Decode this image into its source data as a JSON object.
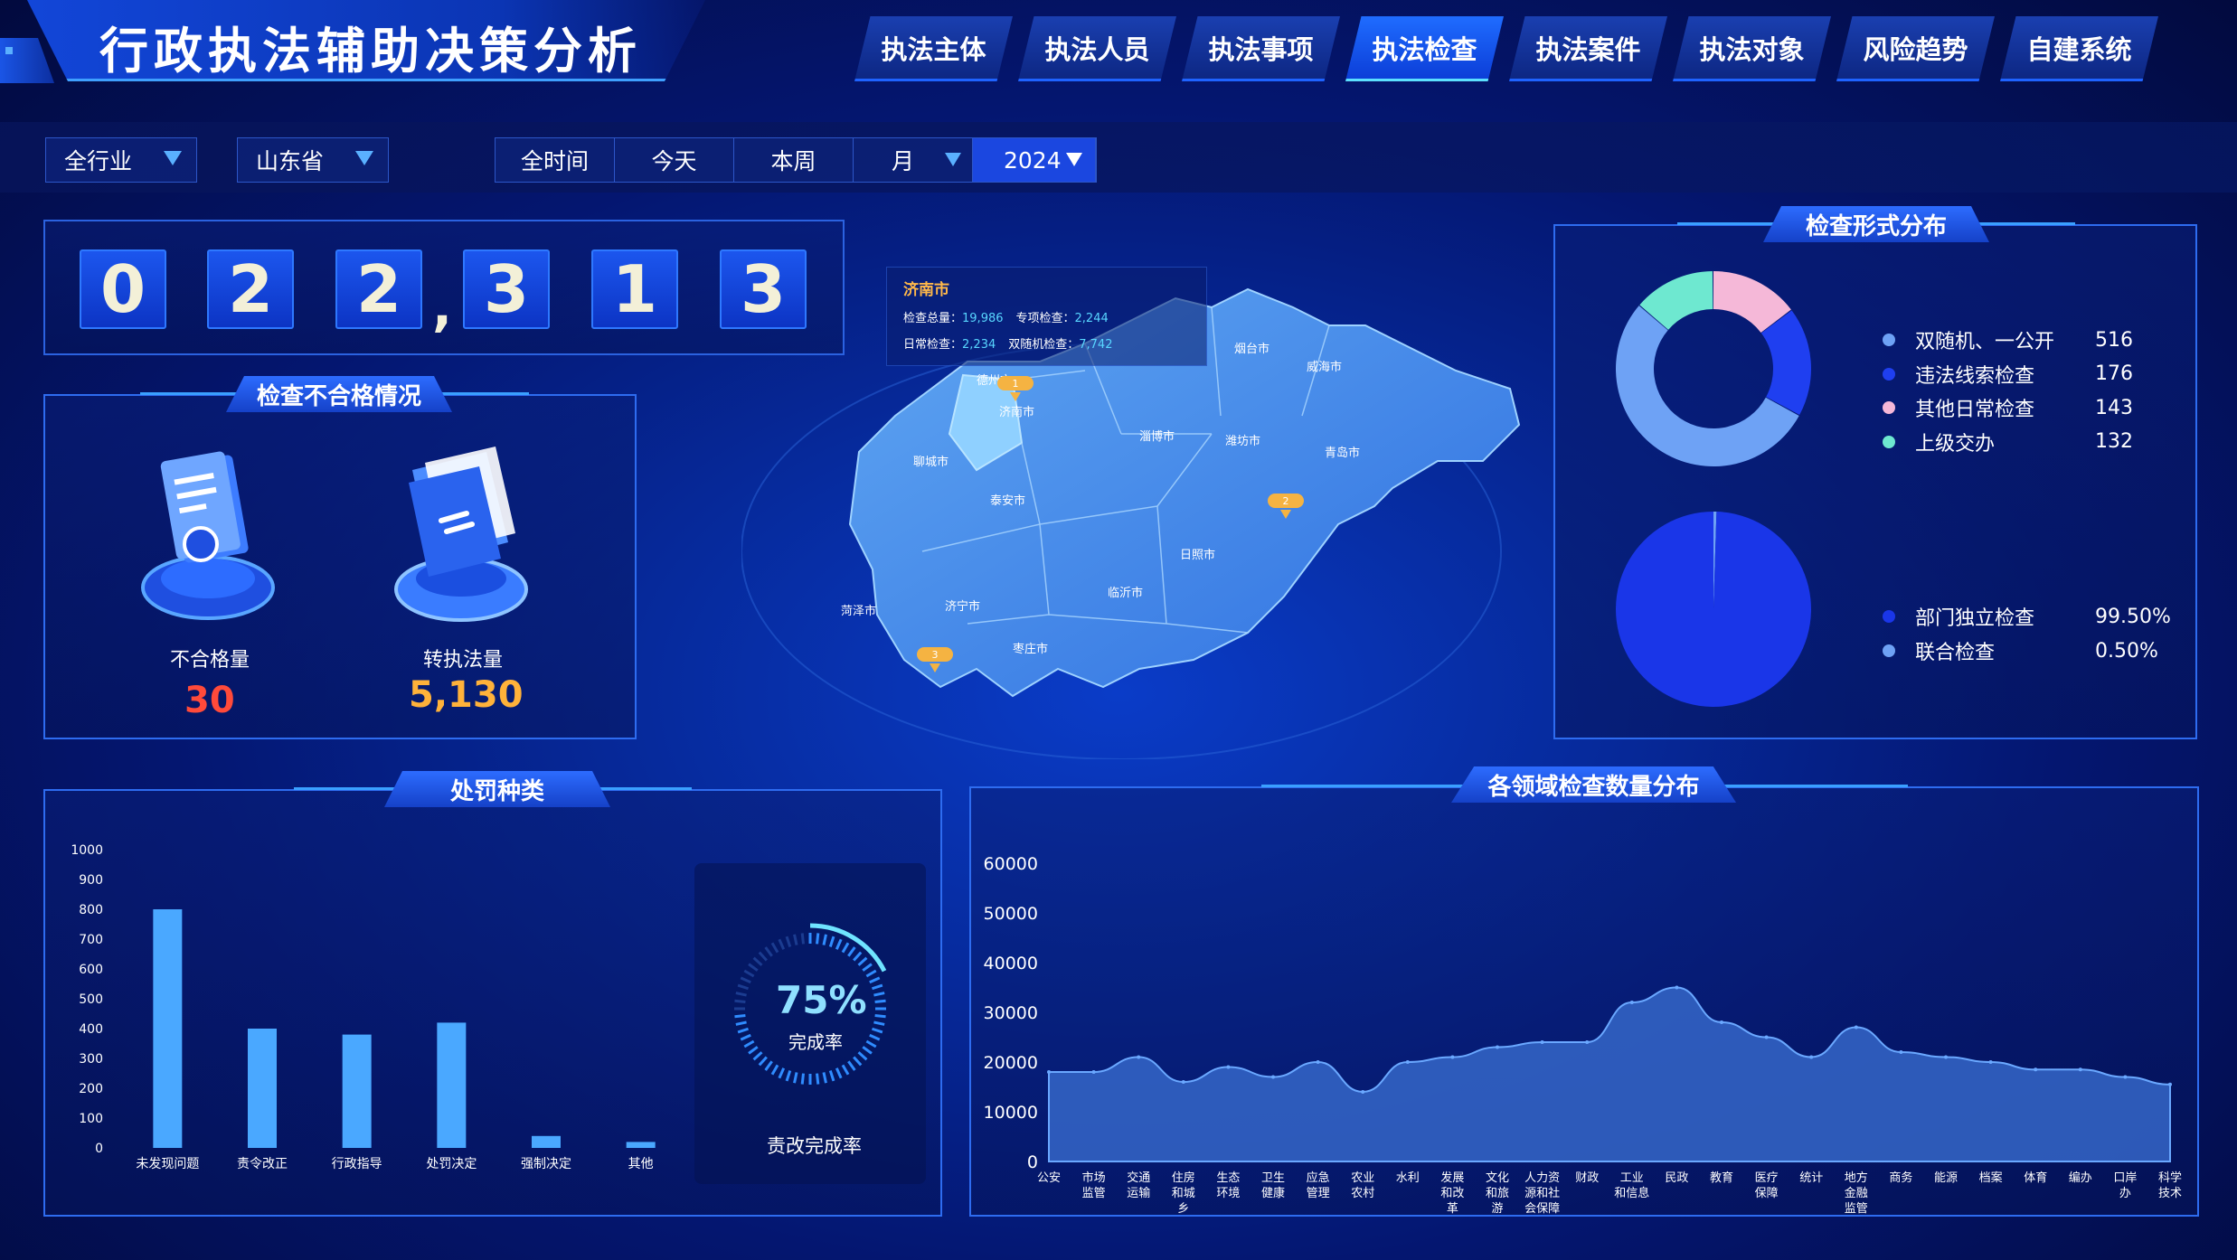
{
  "header": {
    "title": "行政执法辅助决策分析",
    "tabs": [
      {
        "label": "执法主体",
        "active": false
      },
      {
        "label": "执法人员",
        "active": false
      },
      {
        "label": "执法事项",
        "active": false
      },
      {
        "label": "执法检查",
        "active": true
      },
      {
        "label": "执法案件",
        "active": false
      },
      {
        "label": "执法对象",
        "active": false
      },
      {
        "label": "风险趋势",
        "active": false
      },
      {
        "label": "自建系统",
        "active": false
      }
    ]
  },
  "filters": {
    "industry": "全行业",
    "province": "山东省",
    "time_range": [
      "全时间",
      "今天",
      "本周",
      "月"
    ],
    "year": "2024"
  },
  "counter": {
    "digits": [
      "0",
      "2",
      "2",
      "3",
      "1",
      "3"
    ],
    "separator": ","
  },
  "unqualified_panel": {
    "title": "检查不合格情况",
    "unqualified_label": "不合格量",
    "unqualified_value": "30",
    "transferred_label": "转执法量",
    "transferred_value": "5,130"
  },
  "map": {
    "info": {
      "city": "济南市",
      "total_label": "检查总量：",
      "total_value": "19,986",
      "special_label": "专项检查：",
      "special_value": "2,244",
      "daily_label": "日常检查：",
      "daily_value": "2,234",
      "random_label": "双随机检查：",
      "random_value": "7,742"
    },
    "cities": [
      "烟台市",
      "威海市",
      "德州市",
      "济南市",
      "淄博市",
      "潍坊市",
      "青岛市",
      "聊城市",
      "泰安市",
      "日照市",
      "临沂市",
      "济宁市",
      "菏泽市",
      "枣庄市"
    ],
    "markers": [
      "1",
      "2",
      "3"
    ]
  },
  "inspection_form": {
    "title": "检查形式分布",
    "donut": [
      {
        "label": "双随机、一公开",
        "value": 516,
        "color": "#6ea2f5"
      },
      {
        "label": "违法线索检查",
        "value": 176,
        "color": "#1f3ff0"
      },
      {
        "label": "其他日常检查",
        "value": 143,
        "color": "#f5b8d8"
      },
      {
        "label": "上级交办",
        "value": 132,
        "color": "#6ee8d0"
      }
    ],
    "pie": [
      {
        "label": "部门独立检查",
        "value": "99.50%",
        "pct": 99.5,
        "color": "#1a36e8"
      },
      {
        "label": "联合检查",
        "value": "0.50%",
        "pct": 0.5,
        "color": "#6ea2f5"
      }
    ]
  },
  "penalty_panel": {
    "title": "处罚种类",
    "gauge_value": "75%",
    "gauge_label": "完成率",
    "gauge_caption": "责改完成率",
    "gauge_pct": 75
  },
  "domain_panel": {
    "title": "各领域检查数量分布"
  },
  "chart_data": [
    {
      "type": "bar",
      "title": "处罚种类",
      "categories": [
        "未发现问题",
        "责令改正",
        "行政指导",
        "处罚决定",
        "强制决定",
        "其他"
      ],
      "values": [
        800,
        400,
        380,
        420,
        40,
        20
      ],
      "ylim": [
        0,
        1000
      ],
      "yticks": [
        0,
        100,
        200,
        300,
        400,
        500,
        600,
        700,
        800,
        900,
        1000
      ],
      "color": "#4aa8ff"
    },
    {
      "type": "area",
      "title": "各领域检查数量分布",
      "categories": [
        "公安",
        "市场监管",
        "交通运输",
        "住房和城乡",
        "生态环境",
        "卫生健康",
        "应急管理",
        "农业农村",
        "水利",
        "发展和改革",
        "文化和旅游",
        "人力资源和社会保障",
        "财政",
        "工业和信息",
        "民政",
        "教育",
        "医疗保障",
        "统计",
        "地方金融监管",
        "商务",
        "能源",
        "档案",
        "体育",
        "编办",
        "口岸办",
        "科学技术"
      ],
      "category_lines": [
        [
          "公安"
        ],
        [
          "市场",
          "监管"
        ],
        [
          "交通",
          "运输"
        ],
        [
          "住房",
          "和城",
          "乡"
        ],
        [
          "生态",
          "环境"
        ],
        [
          "卫生",
          "健康"
        ],
        [
          "应急",
          "管理"
        ],
        [
          "农业",
          "农村"
        ],
        [
          "水利"
        ],
        [
          "发展",
          "和改",
          "革"
        ],
        [
          "文化",
          "和旅",
          "游"
        ],
        [
          "人力资",
          "源和社",
          "会保障"
        ],
        [
          "财政"
        ],
        [
          "工业",
          "和信息"
        ],
        [
          "民政"
        ],
        [
          "教育"
        ],
        [
          "医疗",
          "保障"
        ],
        [
          "统计"
        ],
        [
          "地方",
          "金融",
          "监管"
        ],
        [
          "商务"
        ],
        [
          "能源"
        ],
        [
          "档案"
        ],
        [
          "体育"
        ],
        [
          "编办"
        ],
        [
          "口岸",
          "办"
        ],
        [
          "科学",
          "技术"
        ]
      ],
      "values": [
        18000,
        18000,
        21000,
        16000,
        19000,
        17000,
        20000,
        14000,
        20000,
        21000,
        23000,
        24000,
        24000,
        32000,
        35000,
        28000,
        25000,
        21000,
        27000,
        22000,
        21000,
        20000,
        18500,
        18500,
        17000,
        15500
      ],
      "ylim": [
        0,
        60000
      ],
      "yticks": [
        0,
        10000,
        20000,
        30000,
        40000,
        50000,
        60000
      ],
      "color": "#3566c8"
    }
  ]
}
